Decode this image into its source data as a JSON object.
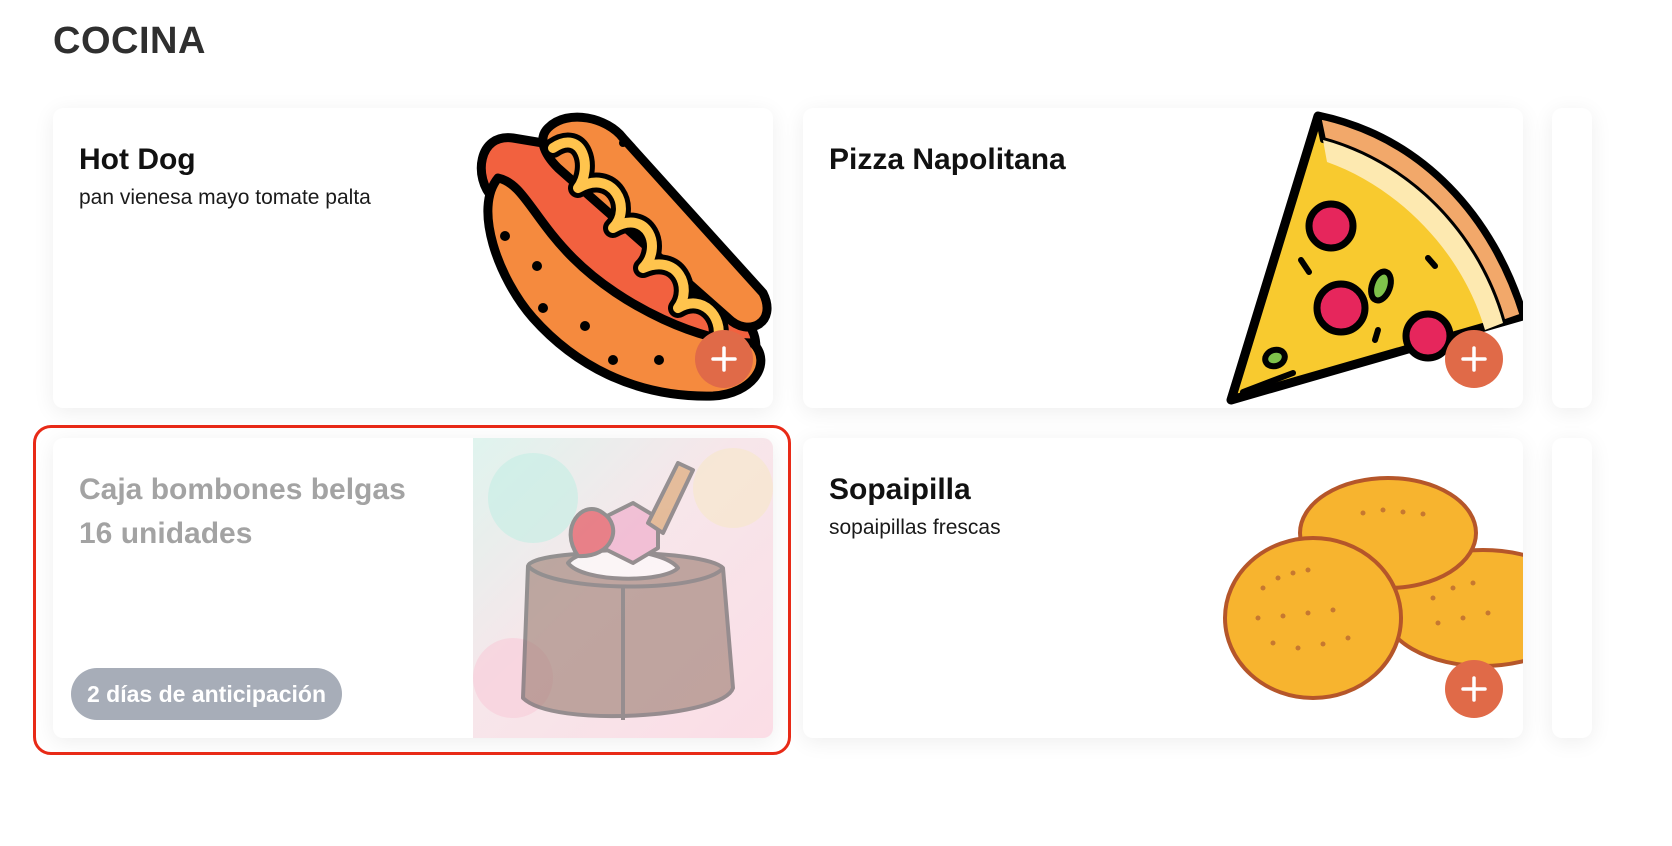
{
  "section": {
    "title": "COCINA"
  },
  "products": [
    {
      "name": "Hot Dog",
      "description": "pan vienesa mayo tomate palta",
      "image_icon": "hotdog-image",
      "action_icon": "plus-icon"
    },
    {
      "name": "Pizza Napolitana",
      "description": "",
      "image_icon": "pizza-slice-image",
      "action_icon": "plus-icon"
    },
    {
      "name": "Caja bombones belgas 16 unidades",
      "description": "",
      "image_icon": "chocolate-box-image",
      "notice": "2 días de anticipación",
      "state": "disabled"
    },
    {
      "name": "Sopaipilla",
      "description": "sopaipillas frescas",
      "image_icon": "sopaipillas-image",
      "action_icon": "plus-icon"
    }
  ],
  "colors": {
    "add_button": "#e06a48",
    "notice_chip": "#a7adb8",
    "highlight_border": "#e82a17",
    "disabled_text": "#a3a3a3"
  }
}
